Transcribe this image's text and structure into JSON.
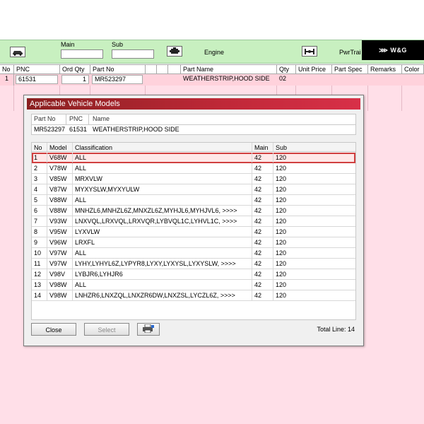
{
  "toolbar": {
    "main_label": "Main",
    "sub_label": "Sub",
    "engine_label": "Engine",
    "pwrtrain_label": "PwrTrai",
    "logo_text": "W&G",
    "car_icon": "car-icon",
    "engine_icon": "engine-icon",
    "axle_icon": "axle-icon"
  },
  "main_grid": {
    "headers": [
      "No",
      "PNC",
      "Ord Qty",
      "Part No",
      "",
      "",
      "",
      "Part Name",
      "Qty",
      "Unit Price",
      "Part Spec",
      "Remarks",
      "Color"
    ],
    "row": {
      "no": "1",
      "pnc": "61531",
      "ord_qty": "1",
      "part_no": "MR523297",
      "part_name": "WEATHERSTRIP,HOOD SIDE",
      "qty": "02"
    }
  },
  "dialog": {
    "title": "Applicable Vehicle Models",
    "part_headers": [
      "Part No",
      "PNC",
      "Name"
    ],
    "part_values": [
      "MR523297",
      "61531",
      "WEATHERSTRIP,HOOD SIDE"
    ],
    "list_headers": [
      "No",
      "Model",
      "Classification",
      "Main",
      "Sub"
    ],
    "rows": [
      {
        "no": "1",
        "model": "V68W",
        "classification": "ALL",
        "main": "42",
        "sub": "120"
      },
      {
        "no": "2",
        "model": "V78W",
        "classification": "ALL",
        "main": "42",
        "sub": "120"
      },
      {
        "no": "3",
        "model": "V85W",
        "classification": "MRXVLW",
        "main": "42",
        "sub": "120"
      },
      {
        "no": "4",
        "model": "V87W",
        "classification": "MYXYSLW,MYXYULW",
        "main": "42",
        "sub": "120"
      },
      {
        "no": "5",
        "model": "V88W",
        "classification": "ALL",
        "main": "42",
        "sub": "120"
      },
      {
        "no": "6",
        "model": "V88W",
        "classification": "MNHZL6,MNHZL6Z,MNXZL6Z,MYHJL6,MYHJVL6,  >>>>",
        "main": "42",
        "sub": "120"
      },
      {
        "no": "7",
        "model": "V93W",
        "classification": "LNXVQL,LRXVQL,LRXVQR,LYBVQL1C,LYHVL1C,  >>>>",
        "main": "42",
        "sub": "120"
      },
      {
        "no": "8",
        "model": "V95W",
        "classification": "LYXVLW",
        "main": "42",
        "sub": "120"
      },
      {
        "no": "9",
        "model": "V96W",
        "classification": "LRXFL",
        "main": "42",
        "sub": "120"
      },
      {
        "no": "10",
        "model": "V97W",
        "classification": "ALL",
        "main": "42",
        "sub": "120"
      },
      {
        "no": "11",
        "model": "V97W",
        "classification": "LYHY,LYHYL6Z,LYPYR8,LYXY,LYXYSL,LYXYSLW,  >>>>",
        "main": "42",
        "sub": "120"
      },
      {
        "no": "12",
        "model": "V98V",
        "classification": "LYBJR6,LYHJR6",
        "main": "42",
        "sub": "120"
      },
      {
        "no": "13",
        "model": "V98W",
        "classification": "ALL",
        "main": "42",
        "sub": "120"
      },
      {
        "no": "14",
        "model": "V98W",
        "classification": "LNHZR6,LNXZQL,LNXZR6DW,LNXZSL,LYCZL6Z,  >>>>",
        "main": "42",
        "sub": "120"
      }
    ],
    "close_label": "Close",
    "select_label": "Select",
    "print_icon": "printer-icon",
    "total_line": "Total Line: 14",
    "selected_row": 0
  },
  "colors": {
    "toolbar_bg": "#c8f0c0",
    "row_pink": "#ffd2dc",
    "area_pink": "#ffdfe8",
    "title_red": "#c02838",
    "selected_outline": "#d04040"
  }
}
